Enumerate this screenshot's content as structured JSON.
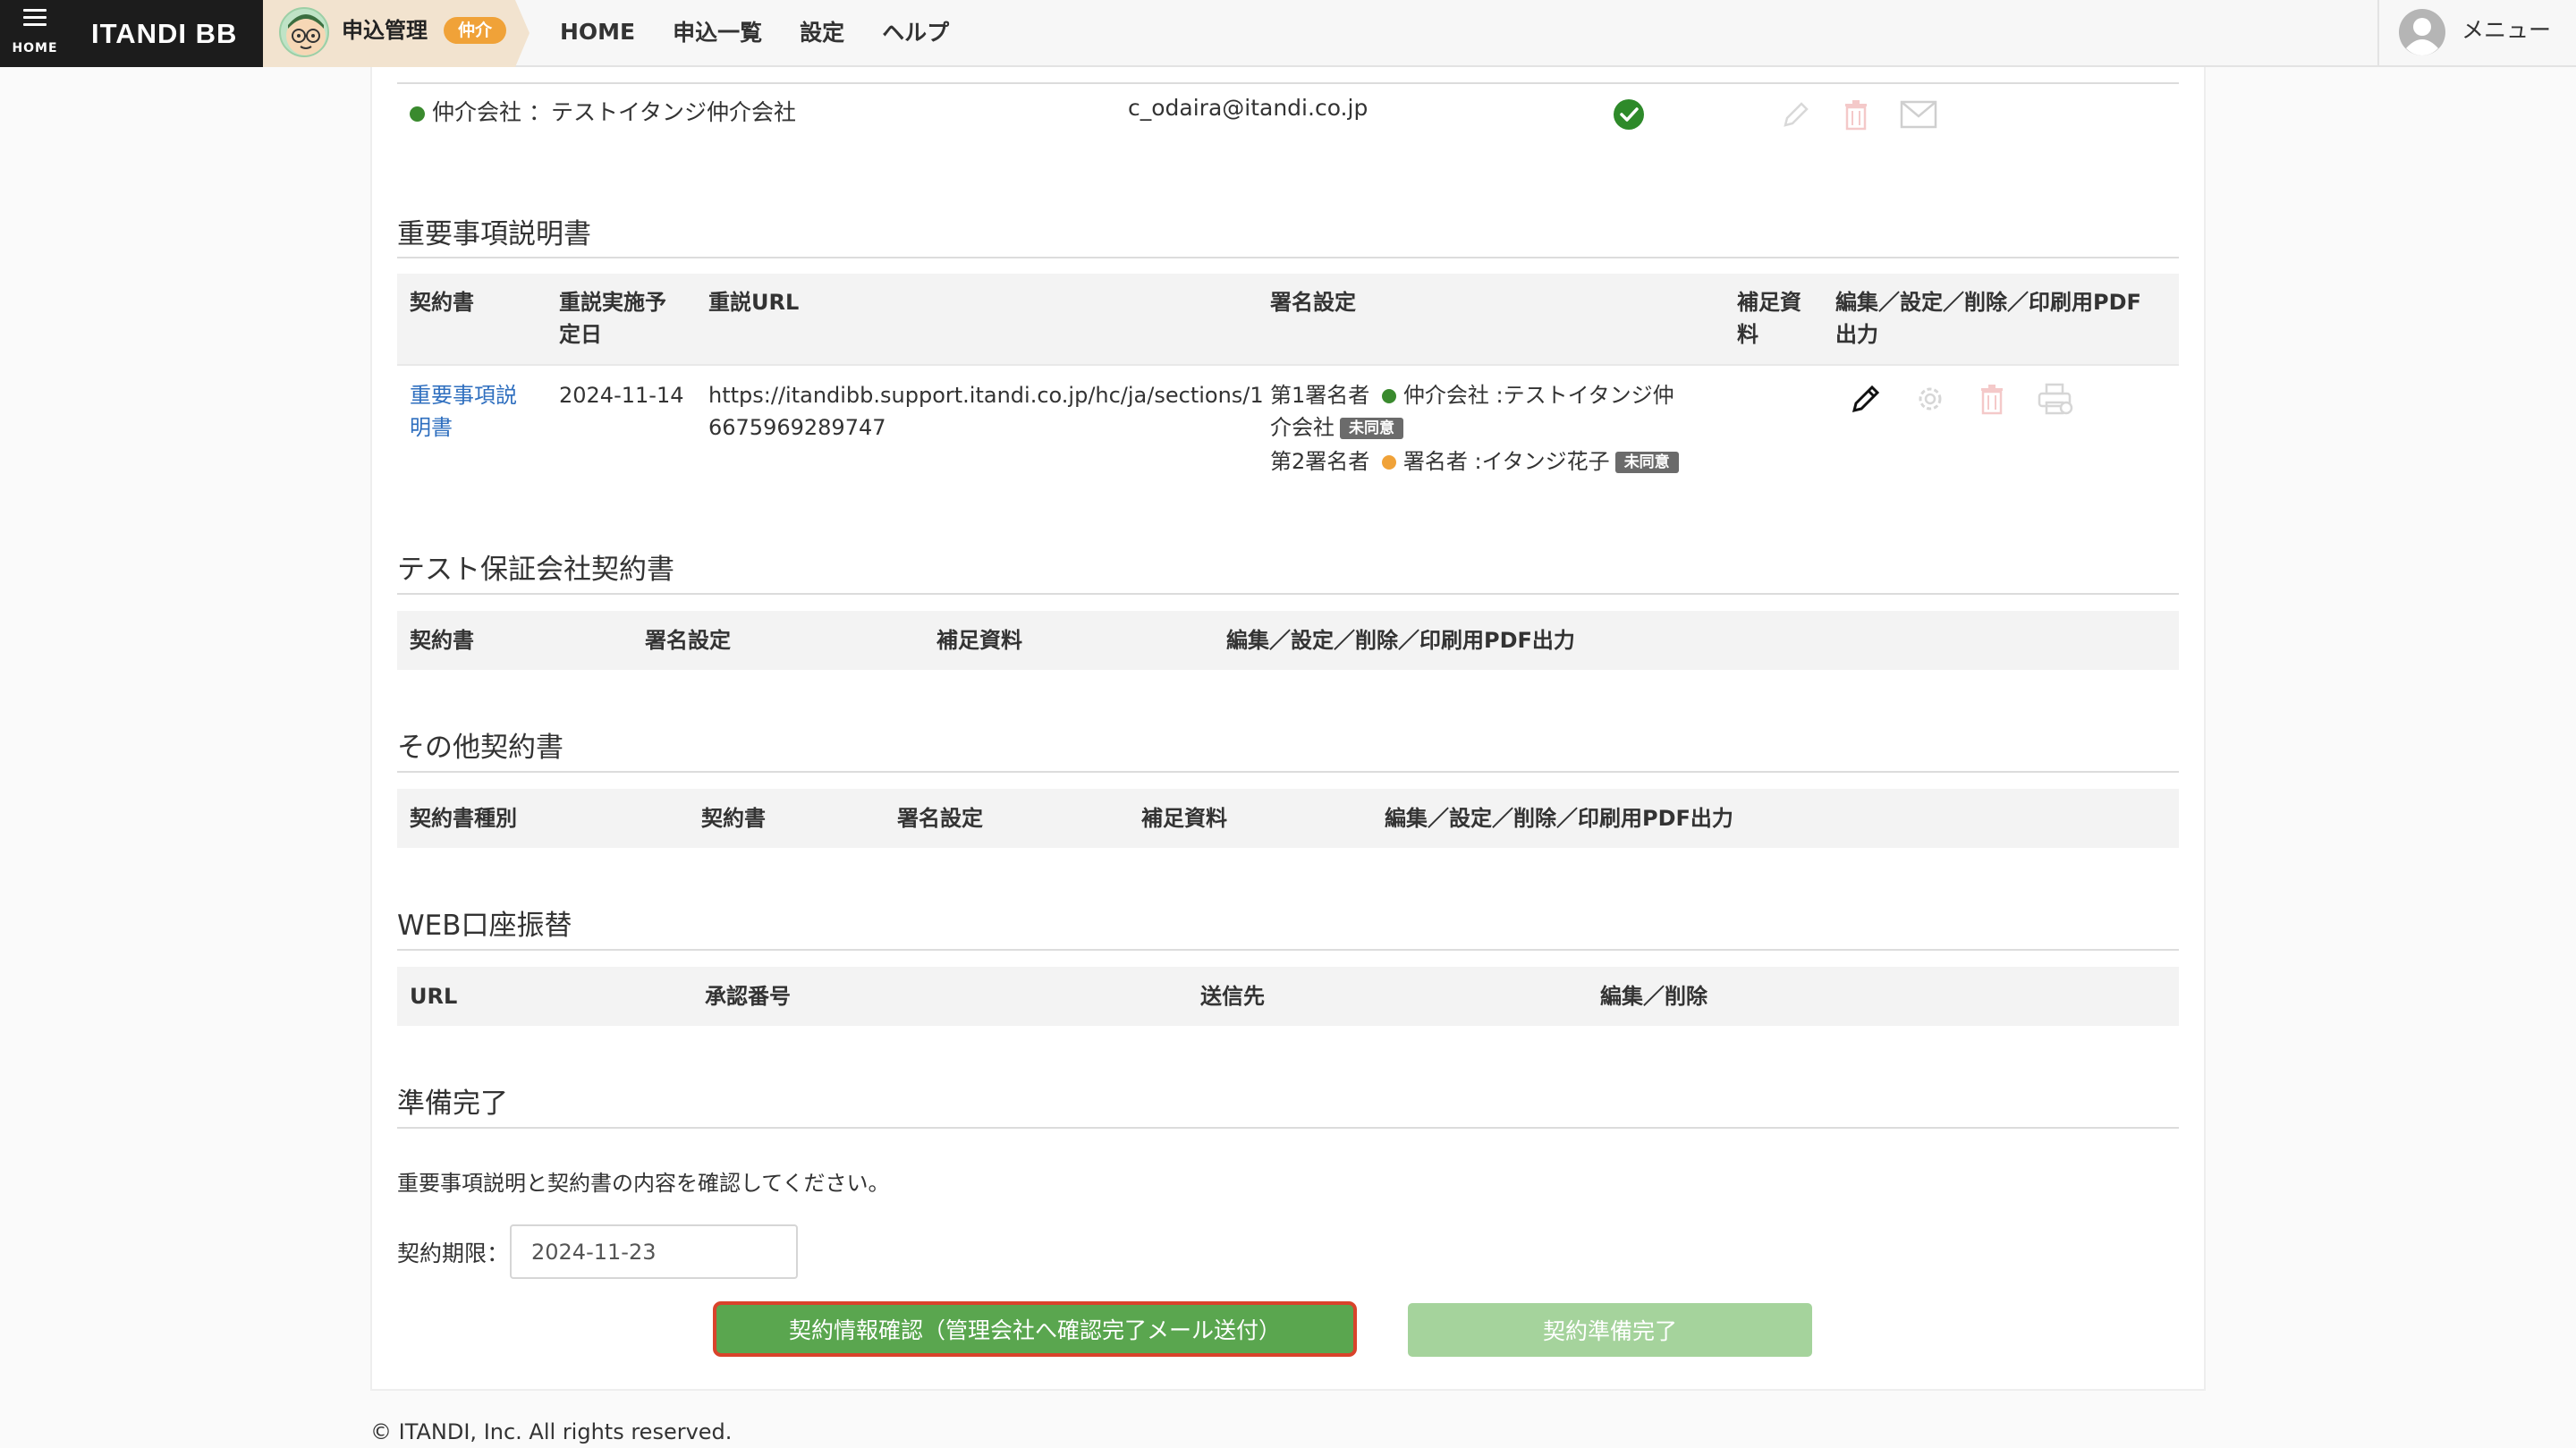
{
  "header": {
    "home_label": "HOME",
    "brand": "ITANDI BB",
    "app_name": "申込管理",
    "app_badge": "仲介",
    "nav": [
      "HOME",
      "申込一覧",
      "設定",
      "ヘルプ"
    ],
    "user_menu": "メニュー"
  },
  "broker": {
    "label": "仲介会社 ：テストイタンジ仲介会社",
    "email": "c_odaira@itandi.co.jp"
  },
  "jyusetsu": {
    "title": "重要事項説明書",
    "headers": [
      "契約書",
      "重説実施予",
      "定日",
      "重説URL",
      "署名設定",
      "補足資",
      "料",
      "編集／設定／削除／印刷用PDF",
      "出力"
    ],
    "row": {
      "doc_line1": "重要事項説",
      "doc_line2": "明書",
      "date": "2024-11-14",
      "url_line1": "https://itandibb.support.itandi.co.jp/hc/ja/sections/1",
      "url_line2": "6675969289747",
      "signer1_prefix": "第1署名者",
      "signer1_name_line1": "仲介会社 :テストイタンジ仲",
      "signer1_name_line2": "介会社",
      "signer1_tag": "未同意",
      "signer2_prefix": "第2署名者",
      "signer2_name": "署名者 :イタンジ花子",
      "signer2_tag": "未同意"
    }
  },
  "guarantee": {
    "title": "テスト保証会社契約書",
    "headers": [
      "契約書",
      "署名設定",
      "補足資料",
      "編集／設定／削除／印刷用PDF出力"
    ]
  },
  "other": {
    "title": "その他契約書",
    "headers": [
      "契約書種別",
      "契約書",
      "署名設定",
      "補足資料",
      "編集／設定／削除／印刷用PDF出力"
    ]
  },
  "web": {
    "title": "WEB口座振替",
    "headers": [
      "URL",
      "承認番号",
      "送信先",
      "編集／削除"
    ]
  },
  "ready": {
    "title": "準備完了",
    "note": "重要事項説明と契約書の内容を確認してください。",
    "deadline_label": "契約期限：",
    "deadline_value": "2024-11-23",
    "confirm_button": "契約情報確認（管理会社へ確認完了メール送付）",
    "done_button": "契約準備完了"
  },
  "footer": "© ITANDI, Inc. All rights reserved.",
  "colors": {
    "green": "#5aa64f",
    "green_light": "#a5d39c",
    "badge_orange": "#f0a238",
    "highlight_red": "#d9432b",
    "link_blue": "#2f6fbf"
  }
}
